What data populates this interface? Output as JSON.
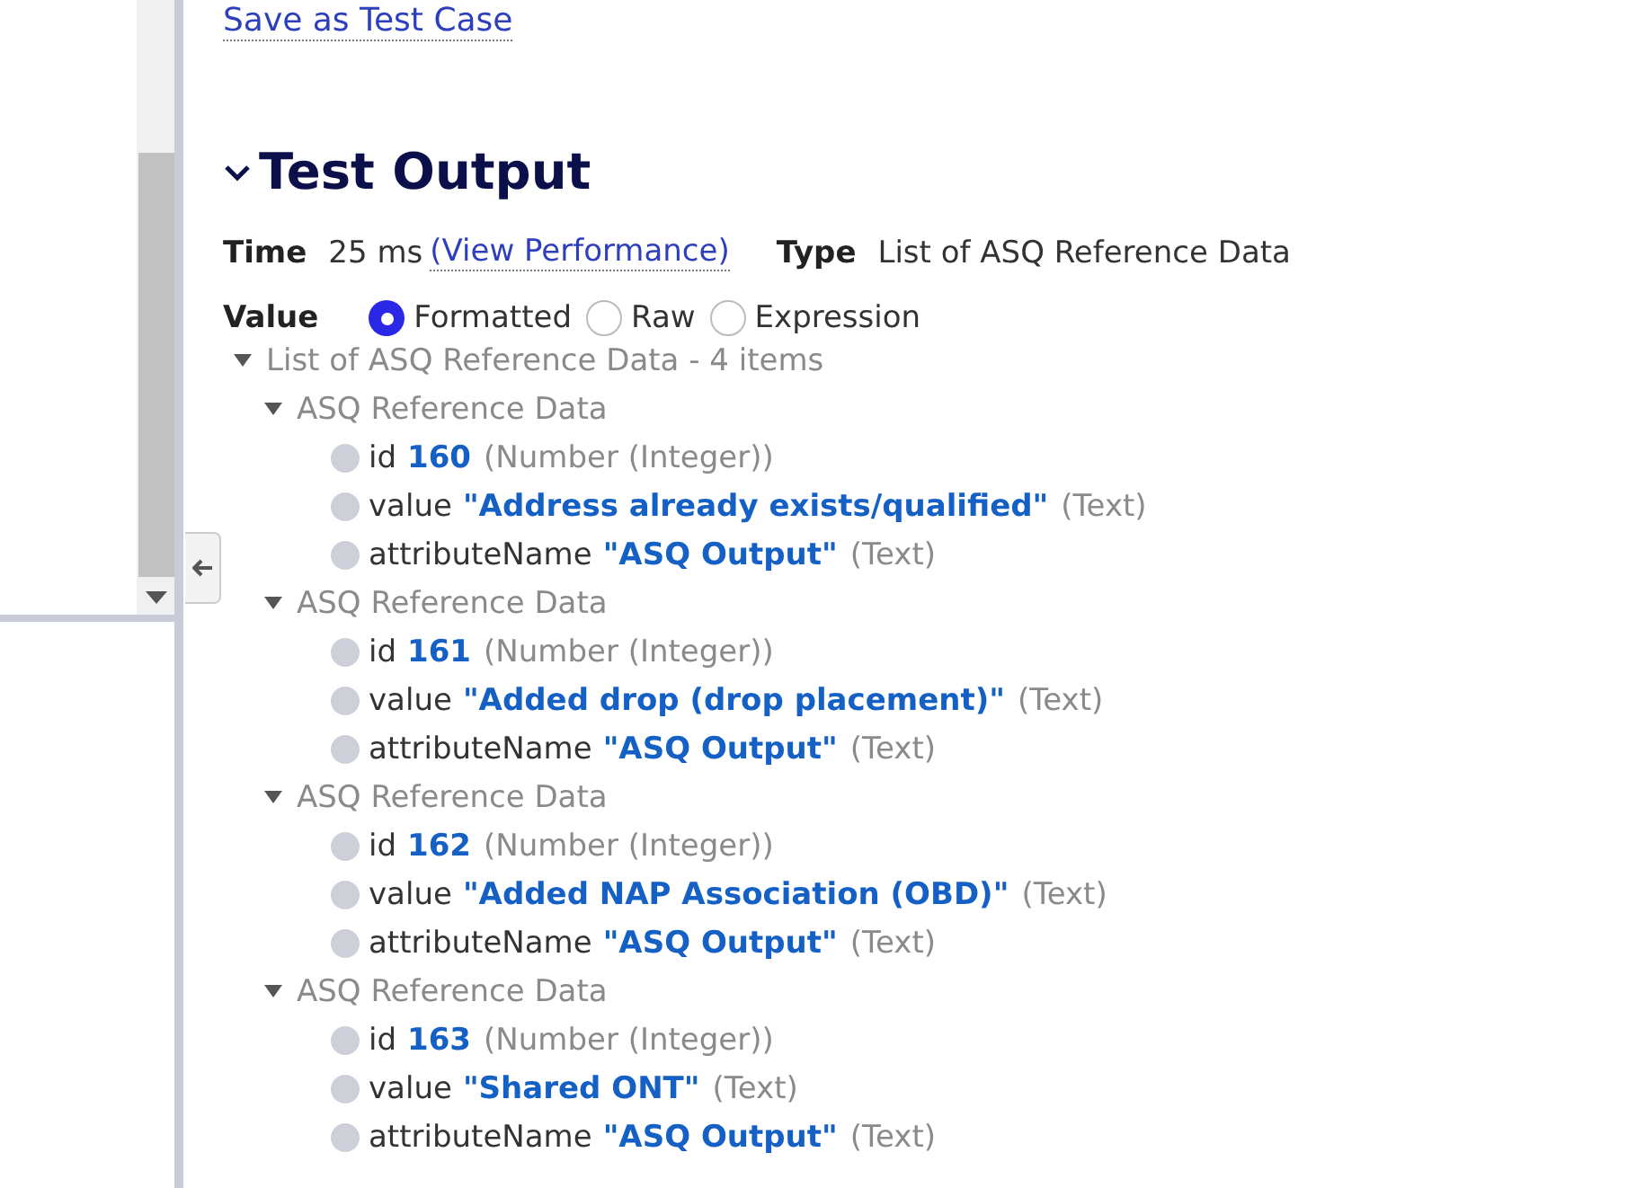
{
  "save_link": "Save as Test Case",
  "section": {
    "title": "Test Output",
    "expanded": true
  },
  "time": {
    "label": "Time",
    "value": "25 ms",
    "link": "(View Performance)"
  },
  "type": {
    "label": "Type",
    "value": "List of ASQ Reference Data"
  },
  "value_mode": {
    "label": "Value",
    "options": [
      {
        "label": "Formatted",
        "selected": true
      },
      {
        "label": "Raw",
        "selected": false
      },
      {
        "label": "Expression",
        "selected": false
      }
    ]
  },
  "tree": {
    "label": "List of ASQ Reference Data - 4 items",
    "expanded": true,
    "children": [
      {
        "label": "ASQ Reference Data",
        "expanded": true,
        "fields": [
          {
            "name": "id",
            "value": "160",
            "type": "(Number (Integer))"
          },
          {
            "name": "value",
            "value": "\"Address already exists/qualified\"",
            "type": "(Text)"
          },
          {
            "name": "attributeName",
            "value": "\"ASQ Output\"",
            "type": "(Text)"
          }
        ]
      },
      {
        "label": "ASQ Reference Data",
        "expanded": true,
        "fields": [
          {
            "name": "id",
            "value": "161",
            "type": "(Number (Integer))"
          },
          {
            "name": "value",
            "value": "\"Added drop (drop placement)\"",
            "type": "(Text)"
          },
          {
            "name": "attributeName",
            "value": "\"ASQ Output\"",
            "type": "(Text)"
          }
        ]
      },
      {
        "label": "ASQ Reference Data",
        "expanded": true,
        "fields": [
          {
            "name": "id",
            "value": "162",
            "type": "(Number (Integer))"
          },
          {
            "name": "value",
            "value": "\"Added NAP Association (OBD)\"",
            "type": "(Text)"
          },
          {
            "name": "attributeName",
            "value": "\"ASQ Output\"",
            "type": "(Text)"
          }
        ]
      },
      {
        "label": "ASQ Reference Data",
        "expanded": true,
        "fields": [
          {
            "name": "id",
            "value": "163",
            "type": "(Number (Integer))"
          },
          {
            "name": "value",
            "value": "\"Shared ONT\"",
            "type": "(Text)"
          },
          {
            "name": "attributeName",
            "value": "\"ASQ Output\"",
            "type": "(Text)"
          }
        ]
      }
    ]
  }
}
